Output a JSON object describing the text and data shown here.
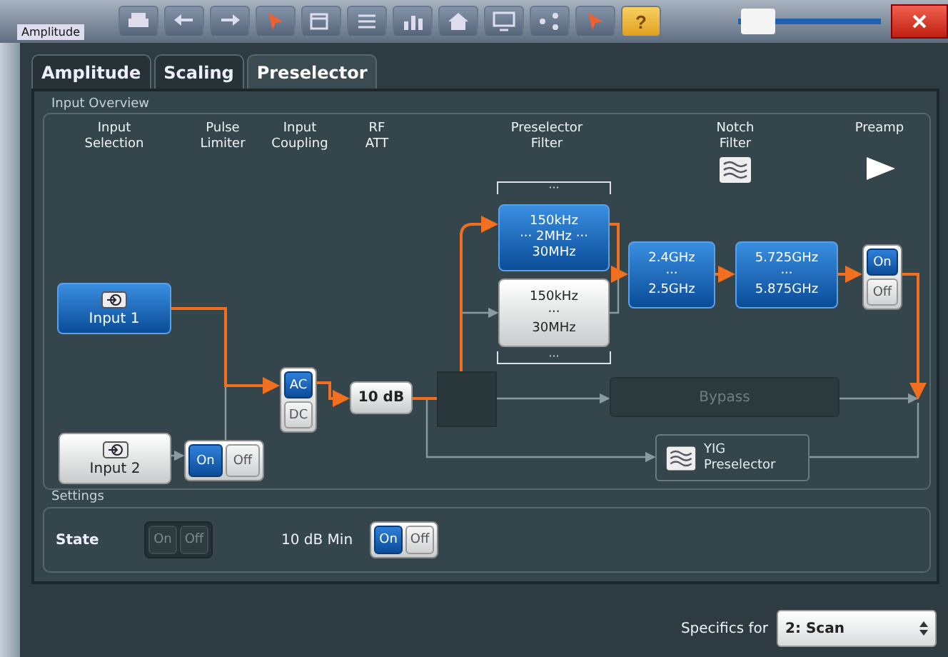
{
  "window": {
    "title": "Amplitude",
    "help": "?",
    "slider": {
      "level": 0.02
    }
  },
  "tabs": [
    {
      "label": "Amplitude",
      "selected": false
    },
    {
      "label": "Scaling",
      "selected": false
    },
    {
      "label": "Preselector",
      "selected": true
    }
  ],
  "input_overview": {
    "title": "Input Overview",
    "columns": [
      "Input\nSelection",
      "Pulse\nLimiter",
      "Input\nCoupling",
      "RF\nATT",
      "Preselector\nFilter",
      "Notch\nFilter",
      "Preamp"
    ],
    "inputs": [
      {
        "label": "Input 1",
        "selected": true
      },
      {
        "label": "Input 2",
        "selected": false
      }
    ],
    "pulse_limiter": {
      "options": [
        {
          "label": "On",
          "selected": true
        },
        {
          "label": "Off",
          "selected": false
        }
      ]
    },
    "coupling": {
      "options": [
        {
          "label": "AC",
          "selected": true
        },
        {
          "label": "DC",
          "selected": false
        }
      ]
    },
    "attenuation": "10 dB",
    "preselector_filter": {
      "more_above": "···",
      "more_below": "···",
      "options": [
        {
          "lines": [
            "150kHz",
            "··· 2MHz ···",
            "30MHz"
          ],
          "selected": true
        },
        {
          "lines": [
            "150kHz",
            "···",
            "30MHz"
          ],
          "selected": false
        }
      ]
    },
    "notch_filters": [
      {
        "lines": [
          "2.4GHz",
          "···",
          "2.5GHz"
        ]
      },
      {
        "lines": [
          "5.725GHz",
          "···",
          "5.875GHz"
        ]
      }
    ],
    "preamp": {
      "options": [
        {
          "label": "On",
          "selected": true
        },
        {
          "label": "Off",
          "selected": false
        }
      ]
    },
    "bypass": "Bypass",
    "yig": "YIG\nPreselector"
  },
  "settings": {
    "title": "Settings",
    "rows": [
      {
        "label": "State",
        "disabled": true,
        "options": [
          {
            "label": "On",
            "selected": false
          },
          {
            "label": "Off",
            "selected": false
          }
        ]
      },
      {
        "label": "10 dB Min",
        "disabled": false,
        "options": [
          {
            "label": "On",
            "selected": true
          },
          {
            "label": "Off",
            "selected": false
          }
        ]
      }
    ]
  },
  "specifics": {
    "label": "Specifics for",
    "value": "2: Scan"
  }
}
